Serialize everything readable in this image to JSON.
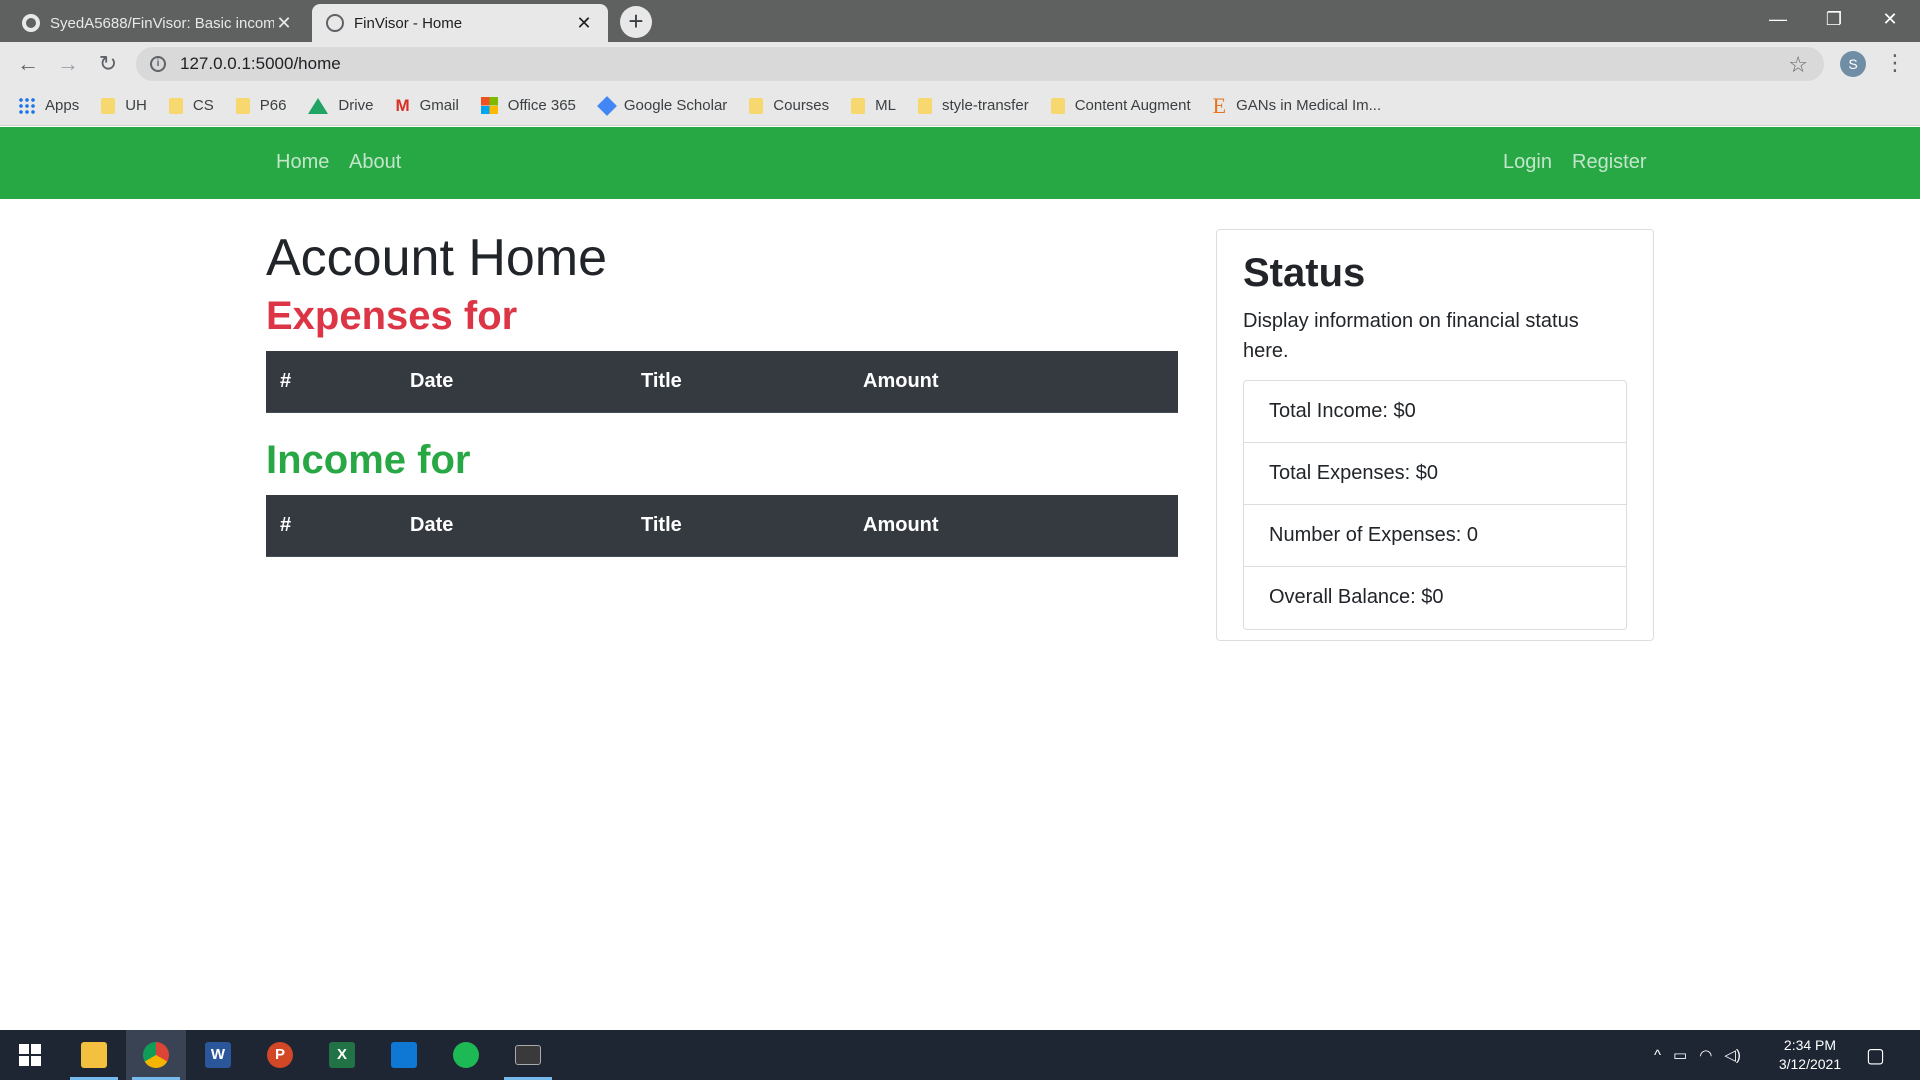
{
  "browser": {
    "tabs": [
      {
        "title": "SyedA5688/FinVisor: Basic incom",
        "active": false
      },
      {
        "title": "FinVisor - Home",
        "active": true
      }
    ],
    "new_tab_label": "+",
    "url": "127.0.0.1:5000/home",
    "profile_initial": "S",
    "window_controls": {
      "minimize": "—",
      "restore": "❐",
      "close": "✕"
    },
    "bookmarks": [
      {
        "label": "Apps",
        "icon": "apps-icon"
      },
      {
        "label": "UH",
        "icon": "folder-icon"
      },
      {
        "label": "CS",
        "icon": "folder-icon"
      },
      {
        "label": "P66",
        "icon": "folder-icon"
      },
      {
        "label": "Drive",
        "icon": "drive-icon"
      },
      {
        "label": "Gmail",
        "icon": "gmail-icon"
      },
      {
        "label": "Office 365",
        "icon": "office-icon"
      },
      {
        "label": "Google Scholar",
        "icon": "scholar-icon"
      },
      {
        "label": "Courses",
        "icon": "folder-icon"
      },
      {
        "label": "ML",
        "icon": "folder-icon"
      },
      {
        "label": "style-transfer",
        "icon": "folder-icon"
      },
      {
        "label": "Content Augment",
        "icon": "folder-icon"
      },
      {
        "label": "GANs in Medical Im...",
        "icon": "e-icon"
      }
    ]
  },
  "navbar": {
    "left": [
      "Home",
      "About"
    ],
    "right": [
      "Login",
      "Register"
    ],
    "color": "#28a745"
  },
  "main": {
    "title": "Account Home",
    "expenses_heading": "Expenses for",
    "income_heading": "Income for",
    "table_headers": [
      "#",
      "Date",
      "Title",
      "Amount"
    ],
    "expenses_color": "#dc3545",
    "income_color": "#28a745"
  },
  "status": {
    "title": "Status",
    "description": "Display information on financial status here.",
    "items": [
      "Total Income: $0",
      "Total Expenses: $0",
      "Number of Expenses: 0",
      "Overall Balance: $0"
    ]
  },
  "taskbar": {
    "apps": [
      {
        "name": "file-explorer-icon"
      },
      {
        "name": "chrome-icon"
      },
      {
        "name": "word-icon",
        "glyph": "W"
      },
      {
        "name": "powerpoint-icon",
        "glyph": "P"
      },
      {
        "name": "excel-icon",
        "glyph": "X"
      },
      {
        "name": "store-icon"
      },
      {
        "name": "spotify-icon"
      },
      {
        "name": "terminal-icon"
      }
    ],
    "time": "2:34 PM",
    "date": "3/12/2021"
  }
}
